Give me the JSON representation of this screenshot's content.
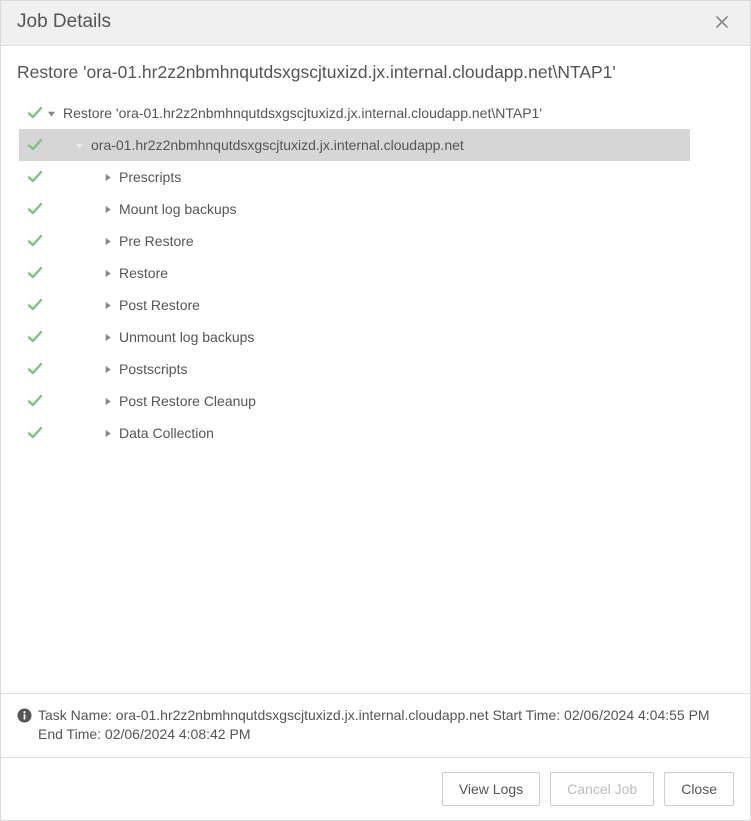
{
  "dialog": {
    "title": "Job Details",
    "close_label": "Close dialog"
  },
  "main_heading": "Restore 'ora-01.hr2z2nbmhnqutdsxgscjtuxizd.jx.internal.cloudapp.net\\NTAP1'",
  "tree": [
    {
      "status": "ok",
      "level": 0,
      "caret": "down",
      "label": "Restore 'ora-01.hr2z2nbmhnqutdsxgscjtuxizd.jx.internal.cloudapp.net\\NTAP1'",
      "selected": false
    },
    {
      "status": "ok",
      "level": 1,
      "caret": "down",
      "label": "ora-01.hr2z2nbmhnqutdsxgscjtuxizd.jx.internal.cloudapp.net",
      "selected": true
    },
    {
      "status": "ok",
      "level": 2,
      "caret": "right",
      "label": "Prescripts",
      "selected": false
    },
    {
      "status": "ok",
      "level": 2,
      "caret": "right",
      "label": "Mount log backups",
      "selected": false
    },
    {
      "status": "ok",
      "level": 2,
      "caret": "right",
      "label": "Pre Restore",
      "selected": false
    },
    {
      "status": "ok",
      "level": 2,
      "caret": "right",
      "label": "Restore",
      "selected": false
    },
    {
      "status": "ok",
      "level": 2,
      "caret": "right",
      "label": "Post Restore",
      "selected": false
    },
    {
      "status": "ok",
      "level": 2,
      "caret": "right",
      "label": "Unmount log backups",
      "selected": false
    },
    {
      "status": "ok",
      "level": 2,
      "caret": "right",
      "label": "Postscripts",
      "selected": false
    },
    {
      "status": "ok",
      "level": 2,
      "caret": "right",
      "label": "Post Restore Cleanup",
      "selected": false
    },
    {
      "status": "ok",
      "level": 2,
      "caret": "right",
      "label": "Data Collection",
      "selected": false
    }
  ],
  "task_info": "Task Name: ora-01.hr2z2nbmhnqutdsxgscjtuxizd.jx.internal.cloudapp.net Start Time: 02/06/2024 4:04:55 PM End Time: 02/06/2024 4:08:42 PM",
  "buttons": {
    "view_logs": "View Logs",
    "cancel_job": "Cancel Job",
    "close": "Close"
  }
}
